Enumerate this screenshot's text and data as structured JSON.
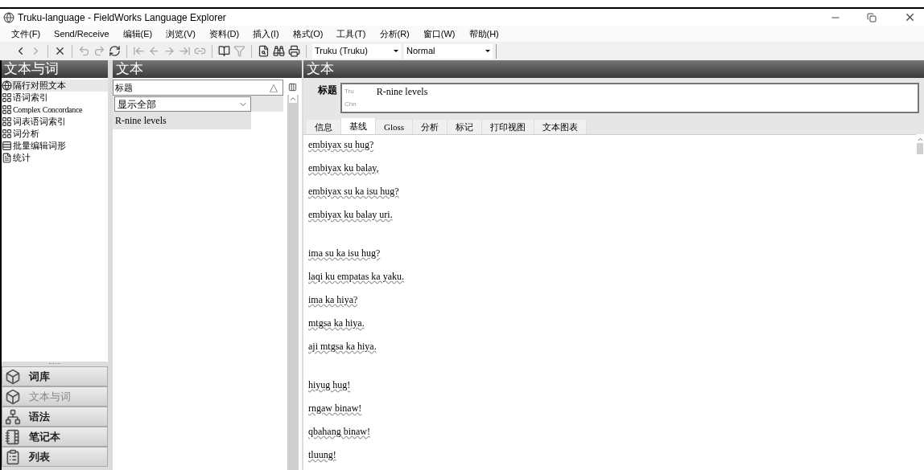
{
  "window": {
    "title": "Truku-language - FieldWorks Language Explorer"
  },
  "menu": [
    "文件(F)",
    "Send/Receive",
    "编辑(E)",
    "浏览(V)",
    "资料(D)",
    "插入(I)",
    "格式(O)",
    "工具(T)",
    "分析(R)",
    "窗口(W)",
    "帮助(H)"
  ],
  "toolbar": {
    "writing_system": "Truku (Truku)",
    "style": "Normal"
  },
  "sidebar": {
    "header": "文本与词",
    "items": [
      {
        "label": "隔行对照文本",
        "kind": "globe",
        "selected": true
      },
      {
        "label": "语词索引",
        "kind": "grid",
        "selected": false
      },
      {
        "label": "Complex Concordance",
        "kind": "grid",
        "selected": false
      },
      {
        "label": "词表语词索引",
        "kind": "grid",
        "selected": false
      },
      {
        "label": "词分析",
        "kind": "grid",
        "selected": false
      },
      {
        "label": "批量编辑词形",
        "kind": "bulk",
        "selected": false
      },
      {
        "label": "统计",
        "kind": "doc",
        "selected": false
      }
    ],
    "areas": [
      {
        "label": "词库",
        "kind": "cube",
        "selected": false
      },
      {
        "label": "文本与词",
        "kind": "cube",
        "selected": true
      },
      {
        "label": "语法",
        "kind": "tree",
        "selected": false
      },
      {
        "label": "笔记本",
        "kind": "notebook",
        "selected": false
      },
      {
        "label": "列表",
        "kind": "list",
        "selected": false
      }
    ]
  },
  "text_list": {
    "header": "文本",
    "column": "标题",
    "sort_mark": "△",
    "filter": "显示全部",
    "rows": [
      {
        "title": "R-nine levels",
        "selected": true
      }
    ]
  },
  "editor": {
    "header": "文本",
    "title_label": "标题",
    "title_fields": [
      {
        "ws": "Tru",
        "value": "R-nine levels"
      },
      {
        "ws": "Chn"
      }
    ],
    "tabs": [
      {
        "label": "信息",
        "selected": false
      },
      {
        "label": "基线",
        "selected": true
      },
      {
        "label": "Gloss",
        "selected": false
      },
      {
        "label": "分析",
        "selected": false
      },
      {
        "label": "标记",
        "selected": false
      },
      {
        "label": "打印视图",
        "selected": false
      },
      {
        "label": "文本图表",
        "selected": false
      }
    ],
    "paragraphs": [
      [
        "embiyax su hug?",
        "embiyax ku balay,",
        "embiyax su ka isu hug?",
        "embiyax ku balay uri."
      ],
      [
        "ima su ka isu hug?",
        "laqi ku empatas ka yaku.",
        "ima ka hiya?",
        "mtgsa ka hiya.",
        "aji mtgsa ka hiya."
      ],
      [
        "hiyug hug!",
        "rngaw binaw!",
        "qbahang binaw!",
        "tluung!"
      ]
    ]
  }
}
